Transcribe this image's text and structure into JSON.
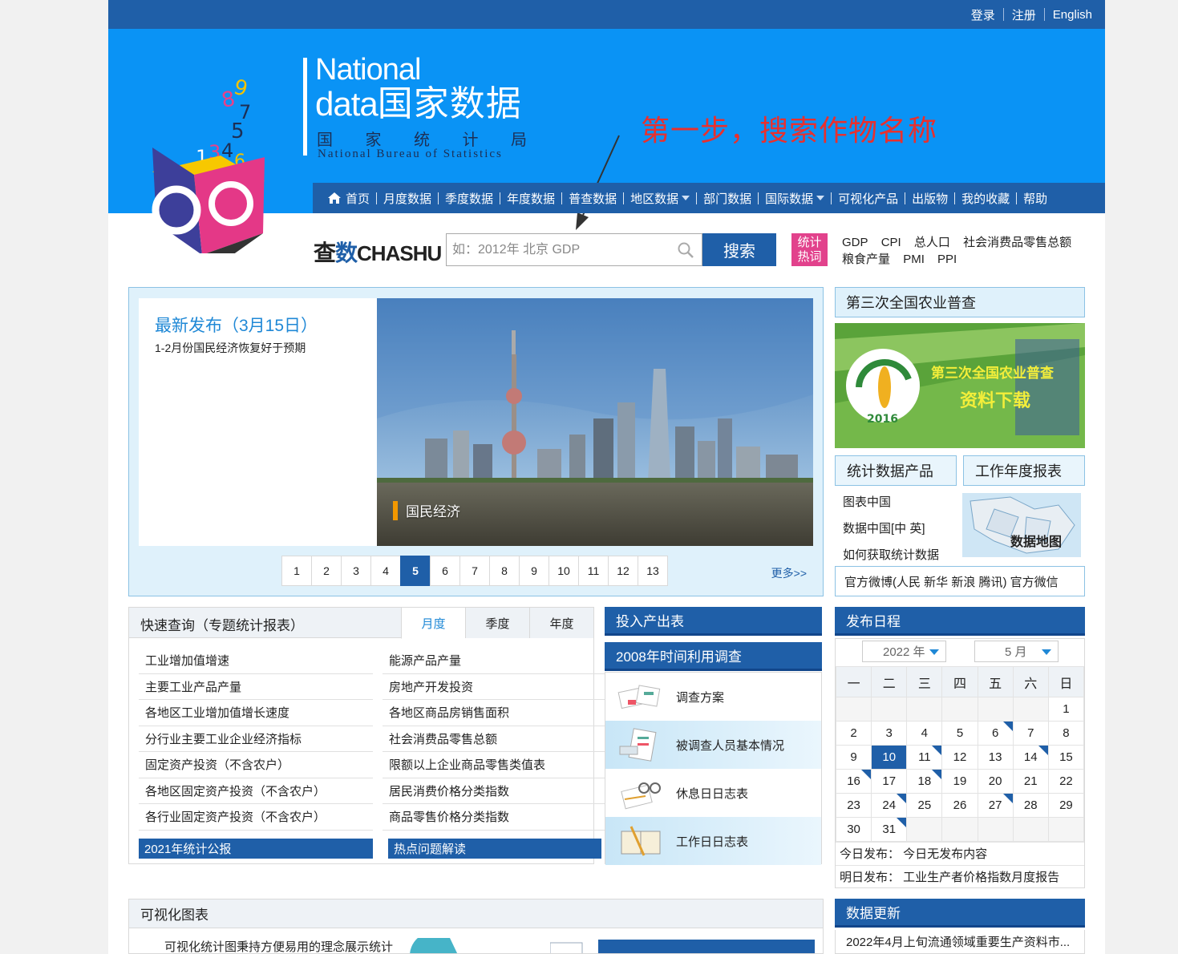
{
  "toplinks": {
    "login": "登录",
    "register": "注册",
    "english": "English"
  },
  "logo": {
    "national": "National",
    "data": "data",
    "data_cn": "国家数据",
    "bureau": [
      "国",
      "家",
      "统",
      "计",
      "局"
    ],
    "bureau_en": "National Bureau of Statistics"
  },
  "annotation": "第一步，搜索作物名称",
  "nav": [
    {
      "label": "首页",
      "icon": "home-icon"
    },
    {
      "label": "月度数据"
    },
    {
      "label": "季度数据"
    },
    {
      "label": "年度数据"
    },
    {
      "label": "普查数据"
    },
    {
      "label": "地区数据",
      "dropdown": true
    },
    {
      "label": "部门数据"
    },
    {
      "label": "国际数据",
      "dropdown": true
    },
    {
      "label": "可视化产品"
    },
    {
      "label": "出版物"
    },
    {
      "label": "我的收藏"
    },
    {
      "label": "帮助"
    }
  ],
  "search": {
    "brand_a": "查",
    "brand_b": "数",
    "brand_c": "CHASHU",
    "placeholder": "如：2012年 北京 GDP",
    "button": "搜索",
    "hot_tag": [
      "统计",
      "热词"
    ],
    "hot_words": [
      "GDP",
      "CPI",
      "总人口",
      "社会消费品零售总额",
      "粮食产量",
      "PMI",
      "PPI"
    ]
  },
  "feature": {
    "title": "最新发布（3月15日）",
    "subtitle": "1-2月份国民经济恢复好于预期",
    "caption": "国民经济",
    "pages": [
      "1",
      "2",
      "3",
      "4",
      "5",
      "6",
      "7",
      "8",
      "9",
      "10",
      "11",
      "12",
      "13"
    ],
    "active_page": "5",
    "more": "更多>>"
  },
  "census": {
    "title": "第三次全国农业普查",
    "banner_line1": "第三次全国农业普查",
    "banner_line2": "资料下载",
    "year": "2016"
  },
  "products": {
    "tab1": "统计数据产品",
    "tab2": "工作年度报表",
    "items": [
      "图表中国",
      "数据中国[中 英]",
      "如何获取统计数据"
    ],
    "map_label": "数据地图"
  },
  "weibo": "官方微博(人民 新华 新浪 腾讯)  官方微信",
  "quick": {
    "title": "快速查询（专题统计报表）",
    "tabs": [
      "月度",
      "季度",
      "年度"
    ],
    "left": [
      "工业增加值增速",
      "主要工业产品产量",
      "各地区工业增加值增长速度",
      "分行业主要工业企业经济指标",
      "固定资产投资（不含农户）",
      "各地区固定资产投资（不含农户）",
      "各行业固定资产投资（不含农户）"
    ],
    "right": [
      "能源产品产量",
      "房地产开发投资",
      "各地区商品房销售面积",
      "社会消费品零售总额",
      "限额以上企业商品零售类值表",
      "居民消费价格分类指数",
      "商品零售价格分类指数"
    ],
    "foot_left": "2021年统计公报",
    "foot_right": "热点问题解读"
  },
  "io": {
    "title": "投入产出表",
    "survey_title": "2008年时间利用调查",
    "rows": [
      "调查方案",
      "被调查人员基本情况",
      "休息日日志表",
      "工作日日志表"
    ]
  },
  "calendar": {
    "title": "发布日程",
    "year": "2022 年",
    "month": "5 月",
    "weekdays": [
      "一",
      "二",
      "三",
      "四",
      "五",
      "六",
      "日"
    ],
    "weeks": [
      [
        "",
        "",
        "",
        "",
        "",
        "",
        "1"
      ],
      [
        "2",
        "3",
        "4",
        "5",
        "6",
        "7",
        "8"
      ],
      [
        "9",
        "10",
        "11",
        "12",
        "13",
        "14",
        "15"
      ],
      [
        "16",
        "17",
        "18",
        "19",
        "20",
        "21",
        "22"
      ],
      [
        "23",
        "24",
        "25",
        "26",
        "27",
        "28",
        "29"
      ],
      [
        "30",
        "31",
        "",
        "",
        "",
        "",
        ""
      ]
    ],
    "today": "10",
    "marked": [
      "6",
      "11",
      "14",
      "16",
      "18",
      "24",
      "27",
      "31"
    ],
    "today_pub": "今日发布：  今日无发布内容",
    "tomorrow_pub": "明日发布：  工业生产者价格指数月度报告"
  },
  "viz": {
    "title": "可视化图表",
    "text": "可视化统计图秉持方便易用的理念展示统计"
  },
  "update": {
    "title": "数据更新",
    "item": "2022年4月上旬流通领域重要生产资料市..."
  }
}
